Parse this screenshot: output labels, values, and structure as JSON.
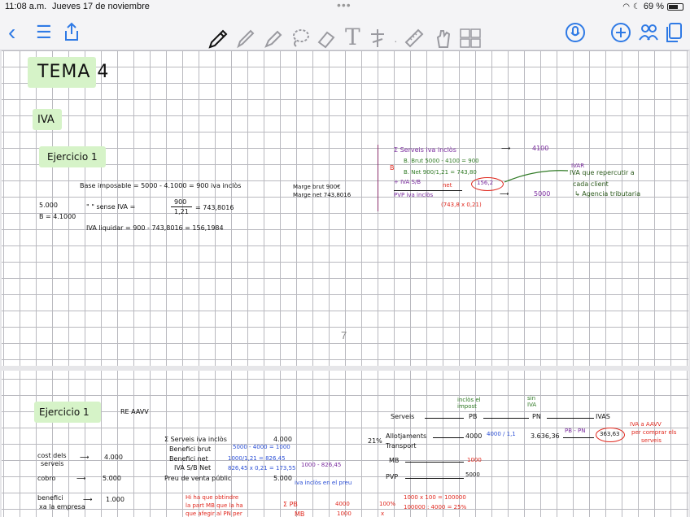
{
  "status_bar": {
    "time": "11:08 a.m.",
    "date": "Jueves 17 de noviembre",
    "battery": "69 %"
  },
  "toolbar": {
    "left_icons": [
      "back-icon",
      "list-icon",
      "share-icon"
    ],
    "tools": [
      "pen-icon",
      "pencil-icon",
      "highlighter-icon",
      "lasso-icon",
      "eraser-icon",
      "text-icon",
      "shapes-icon",
      "ruler-icon",
      "hand-icon",
      "image-icon"
    ],
    "right_icons": [
      "microphone-icon",
      "add-icon",
      "people-icon",
      "pages-icon"
    ],
    "accent": "#2f7ae5"
  },
  "page1": {
    "title": "TEMA 4",
    "section": "IVA",
    "exercise": "Ejercicio 1",
    "page_number": "7",
    "lines": {
      "base": "Base imposable = 5000 - 4.1000 = 900 iva inclòs",
      "left1": "5.000",
      "left2": "B = 4.1000",
      "sense_a": "\"   \"  sense  IVA =",
      "frac_num": "900",
      "frac_den": "1,21",
      "sense_result": "= 743,8016",
      "liquidar": "IVA liquidar = 900 - 743,8016 = 156,1984",
      "marge_brut": "Marge brut  900€",
      "marge_net": "Marge net  743,8016"
    },
    "right_block": {
      "serveis": "Σ  Serveis  iva inclòs",
      "serveis_val": "4100",
      "b_label": "B",
      "b_brut": "B. Brut  5000 - 4100 = 900",
      "b_net": "B. Net  900/1,21 = 743,80",
      "iva_sb": "+ IVA S/B",
      "net": "net",
      "circle_val": "156,2",
      "pvp": "PVP iva inclòs",
      "pvp_val": "5000",
      "calc": "(743,8 x 0,21)",
      "ivar": "IVAR",
      "note1": "IVA que repercutir a",
      "note2": "cada client",
      "note3": "↳ Agencia tributaria"
    }
  },
  "page2": {
    "exercise": "Ejercicio 1",
    "subtitle": "RE AAVV",
    "left": {
      "cost1": "cost dels",
      "cost2": "serveis",
      "cost_val": "4.000",
      "cobro": "cobro",
      "cobro_val": "5.000",
      "benef1": "benefici",
      "benef2": "xa la empresa",
      "benef_val": "1.000"
    },
    "middle": {
      "serveis": "Σ Serveis iva inclòs",
      "serveis_val": "4.000",
      "brut": "Benefici brut",
      "brut_val": "5000 - 4000 = 1000",
      "net": "Benefici net",
      "net_val": "1000/1,21 = 826,45",
      "iva": "IVA S/B Net",
      "iva_val": "826,45 x 0,21 = 173,55",
      "iva_alt": "1000 - 826,45",
      "pvp": "Preu de venta públic",
      "pvp_val": "5.000",
      "pvp_note": "iva inclòs en el preu",
      "red1": "Hi ha que obtindre",
      "red2": "la part MB que la ha",
      "red3": "que afegir al PN per",
      "pb": "Σ  PB",
      "pb_val": "4000",
      "mb": "MB",
      "mb_val": "1000",
      "pct": "21%"
    },
    "table": {
      "col_pb_head": "inclòs el impost",
      "col_pb": "PB",
      "col_pn_head": "sin IVA",
      "col_pn": "PN",
      "col_ivas": "IVAS",
      "row1": "Serveis",
      "row2a": "Allotjaments",
      "row2b": "Transport",
      "row2_pb": "4000",
      "row2_div": "4000 / 1,1",
      "row2_pn": "3.636,36",
      "row2_diff": "PB - PN",
      "row2_circle": "363,63",
      "row3": "MB",
      "row3_val": "1000",
      "row4": "PVP",
      "row4_val": "5000",
      "note1": "IVA a AAVV",
      "note2": "per comprar els",
      "note3": "serveis",
      "pct100": "100%",
      "x": "x",
      "calc1": "1000 x 100 = 100000",
      "calc2": "100000 : 4000 = 25%"
    }
  }
}
